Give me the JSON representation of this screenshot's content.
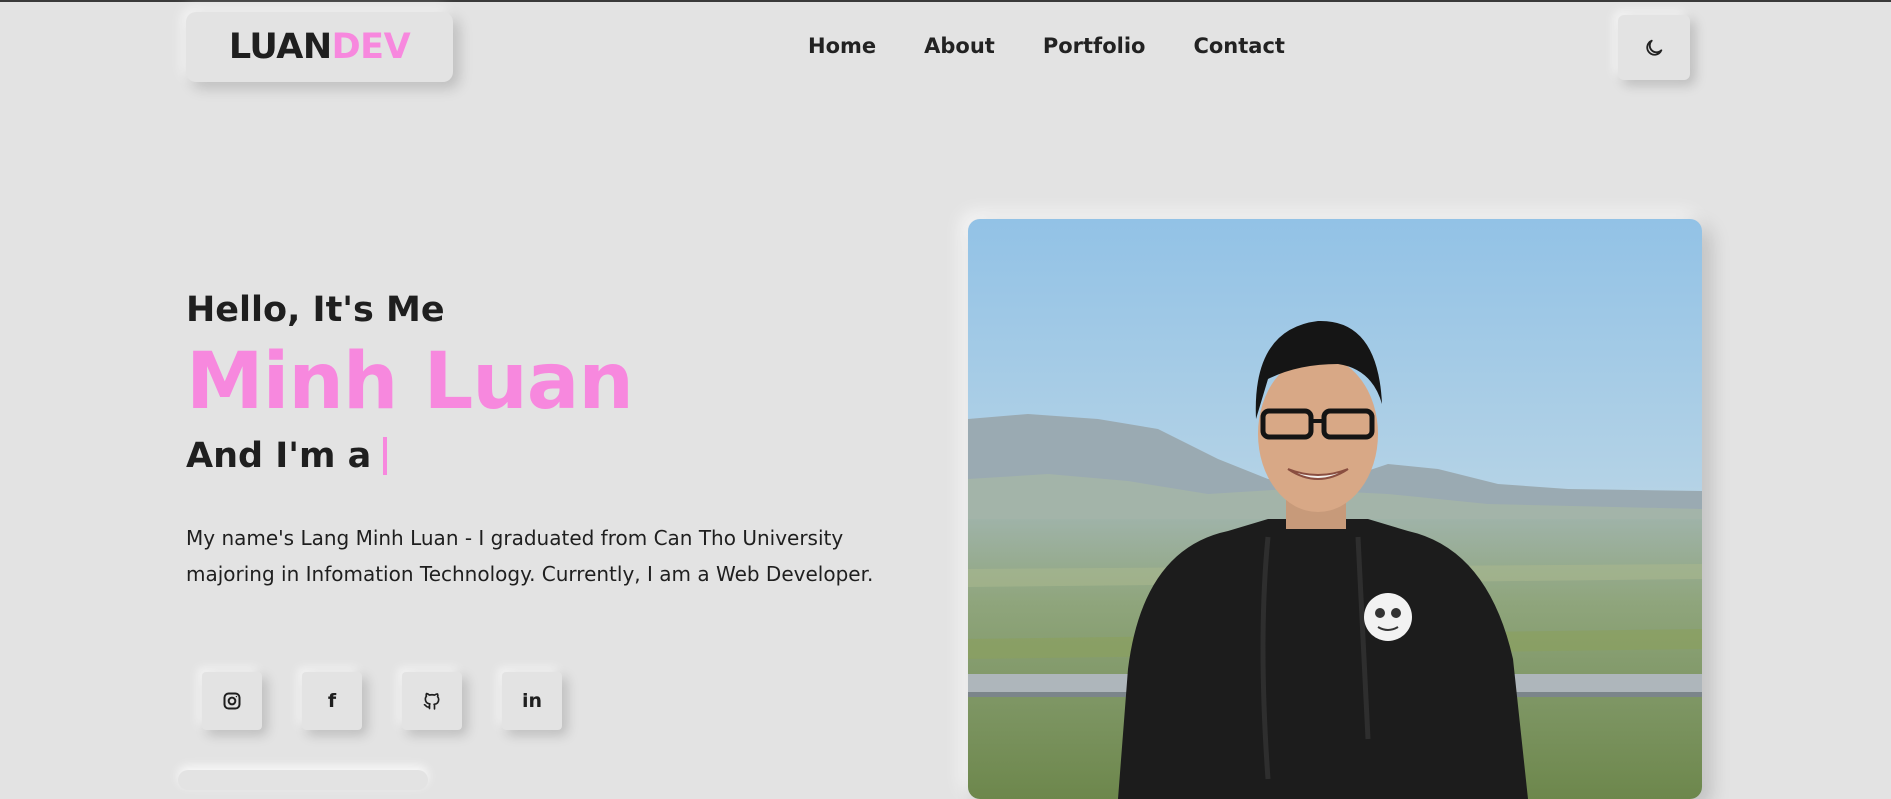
{
  "header": {
    "logo_part1": "LUAN",
    "logo_part2": "DEV",
    "nav": [
      "Home",
      "About",
      "Portfolio",
      "Contact"
    ],
    "theme_toggle_icon": "moon-icon"
  },
  "hero": {
    "greeting": "Hello, It's Me",
    "name": "Minh Luan",
    "role_prefix": "And I'm a",
    "description": "My name's Lang Minh Luan - I graduated from Can Tho University majoring in Infomation Technology. Currently, I am a Web Developer."
  },
  "socials": [
    {
      "icon": "instagram-icon"
    },
    {
      "icon": "facebook-icon",
      "glyph": "f"
    },
    {
      "icon": "github-icon"
    },
    {
      "icon": "linkedin-icon",
      "glyph": "in"
    }
  ],
  "colors": {
    "background": "#e3e3e3",
    "accent": "#f788de",
    "text": "#1f1f1f"
  }
}
